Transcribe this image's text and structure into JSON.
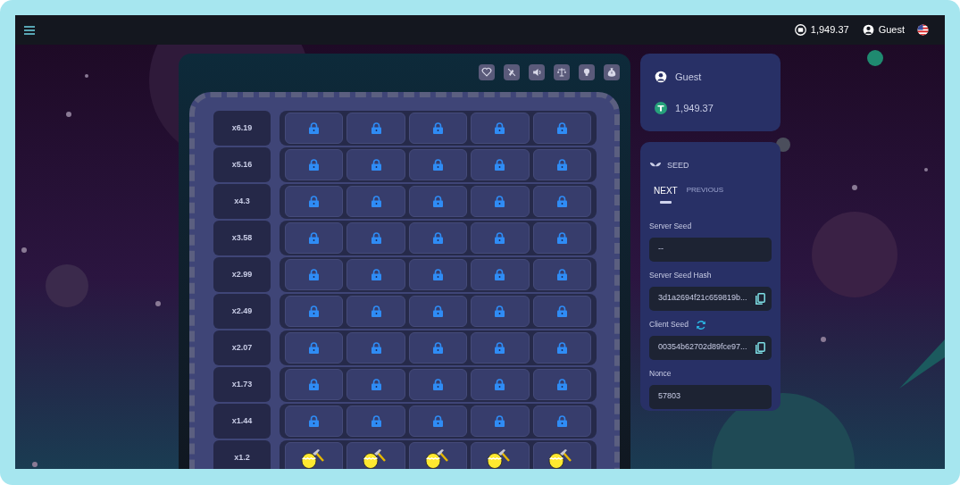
{
  "top_bar": {
    "balance": "1,949.37",
    "user": "Guest"
  },
  "toolbar": [
    {
      "kind": "heart"
    },
    {
      "kind": "mute"
    },
    {
      "kind": "sound"
    },
    {
      "kind": "scale"
    },
    {
      "kind": "bulb"
    },
    {
      "kind": "bag"
    }
  ],
  "board": {
    "rows": [
      {
        "multiplier": "x6.19",
        "cells": [
          {
            "kind": "lock"
          },
          {
            "kind": "lock"
          },
          {
            "kind": "lock"
          },
          {
            "kind": "lock"
          },
          {
            "kind": "lock"
          }
        ]
      },
      {
        "multiplier": "x5.16",
        "cells": [
          {
            "kind": "lock"
          },
          {
            "kind": "lock"
          },
          {
            "kind": "lock"
          },
          {
            "kind": "lock"
          },
          {
            "kind": "lock"
          }
        ]
      },
      {
        "multiplier": "x4.3",
        "cells": [
          {
            "kind": "lock"
          },
          {
            "kind": "lock"
          },
          {
            "kind": "lock"
          },
          {
            "kind": "lock"
          },
          {
            "kind": "lock"
          }
        ]
      },
      {
        "multiplier": "x3.58",
        "cells": [
          {
            "kind": "lock"
          },
          {
            "kind": "lock"
          },
          {
            "kind": "lock"
          },
          {
            "kind": "lock"
          },
          {
            "kind": "lock"
          }
        ]
      },
      {
        "multiplier": "x2.99",
        "cells": [
          {
            "kind": "lock"
          },
          {
            "kind": "lock"
          },
          {
            "kind": "lock"
          },
          {
            "kind": "lock"
          },
          {
            "kind": "lock"
          }
        ]
      },
      {
        "multiplier": "x2.49",
        "cells": [
          {
            "kind": "lock"
          },
          {
            "kind": "lock"
          },
          {
            "kind": "lock"
          },
          {
            "kind": "lock"
          },
          {
            "kind": "lock"
          }
        ]
      },
      {
        "multiplier": "x2.07",
        "cells": [
          {
            "kind": "lock"
          },
          {
            "kind": "lock"
          },
          {
            "kind": "lock"
          },
          {
            "kind": "lock"
          },
          {
            "kind": "lock"
          }
        ]
      },
      {
        "multiplier": "x1.73",
        "cells": [
          {
            "kind": "lock"
          },
          {
            "kind": "lock"
          },
          {
            "kind": "lock"
          },
          {
            "kind": "lock"
          },
          {
            "kind": "lock"
          }
        ]
      },
      {
        "multiplier": "x1.44",
        "cells": [
          {
            "kind": "lock"
          },
          {
            "kind": "lock"
          },
          {
            "kind": "lock"
          },
          {
            "kind": "lock"
          },
          {
            "kind": "lock"
          }
        ]
      },
      {
        "multiplier": "x1.2",
        "cells": [
          {
            "kind": "egg"
          },
          {
            "kind": "egg"
          },
          {
            "kind": "egg"
          },
          {
            "kind": "egg"
          },
          {
            "kind": "egg"
          }
        ]
      }
    ]
  },
  "account": {
    "user": "Guest",
    "balance": "1,949.37"
  },
  "seed": {
    "title": "SEED",
    "tabs": [
      {
        "label": "NEXT",
        "selected": true
      },
      {
        "label": "PREVIOUS",
        "selected": false
      }
    ],
    "fields": [
      {
        "label": "Server Seed",
        "value": "--",
        "copy": false,
        "refresh": false
      },
      {
        "label": "Server Seed Hash",
        "value": "3d1a2694f21c659819b...",
        "copy": true,
        "refresh": false
      },
      {
        "label": "Client Seed",
        "value": "00354b62702d89fce97...",
        "copy": true,
        "refresh": true
      },
      {
        "label": "Nonce",
        "value": "57803",
        "copy": false,
        "refresh": false
      }
    ]
  }
}
